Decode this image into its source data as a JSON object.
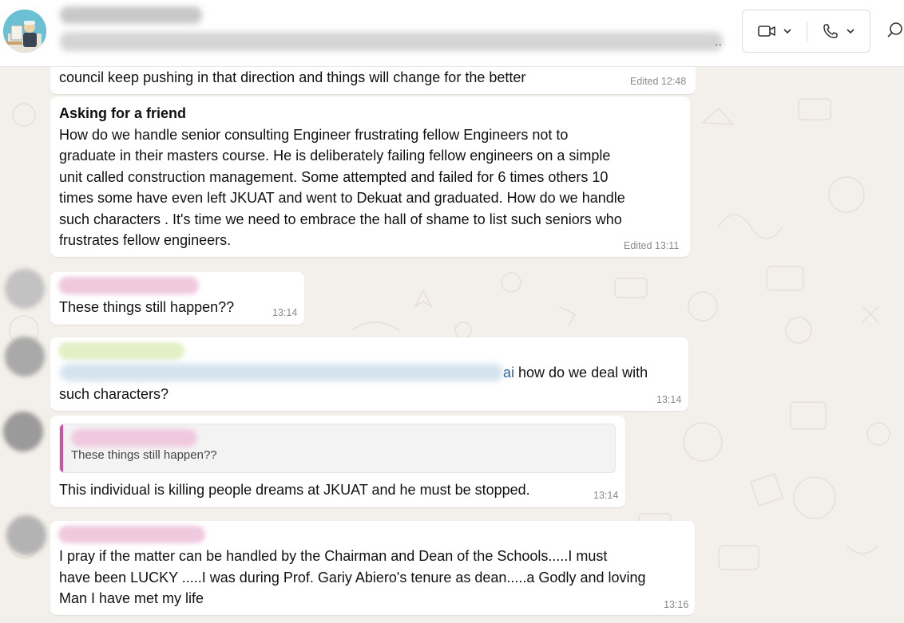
{
  "header": {
    "members_tail": "..",
    "video_icon": "video-camera-icon",
    "phone_icon": "phone-icon",
    "search_icon": "search-icon"
  },
  "messages": [
    {
      "text": "council keep pushing in that direction and things will change for the better",
      "time": "Edited 12:48"
    },
    {
      "heading": "Asking for a friend",
      "lines": [
        "How do we handle senior consulting Engineer frustrating fellow Engineers not to",
        "graduate in their masters course. He is deliberately failing fellow engineers on a simple",
        "unit called construction management. Some attempted and failed for 6 times others 10",
        "times some have even left JKUAT and went to Dekuat and graduated. How do we handle",
        "such characters . It's time we need to  embrace the hall of shame to list such seniors who",
        "frustrates fellow engineers."
      ],
      "time": "Edited 13:11"
    },
    {
      "text": "These things still happen??",
      "time": "13:14"
    },
    {
      "mention_tail": "ai",
      "text_line1": " how do we deal with",
      "text_line2": "such characters?",
      "time": "13:14"
    },
    {
      "quoted_text": "These things still happen??",
      "text": "This individual is killing people dreams at JKUAT and he must be stopped.",
      "time": "13:14"
    },
    {
      "lines": [
        "I pray if the matter can be handled by the Chairman and Dean of the Schools.....I must",
        "have been LUCKY .....I was during Prof. Gariy Abiero's tenure as dean.....a Godly and loving",
        "Man I have met my life"
      ],
      "time": "13:16"
    }
  ],
  "colors": {
    "chat_background": "#f3efea",
    "bubble": "#ffffff",
    "quote_bar": "#d64fa7",
    "mention": "#2d6aa8"
  }
}
